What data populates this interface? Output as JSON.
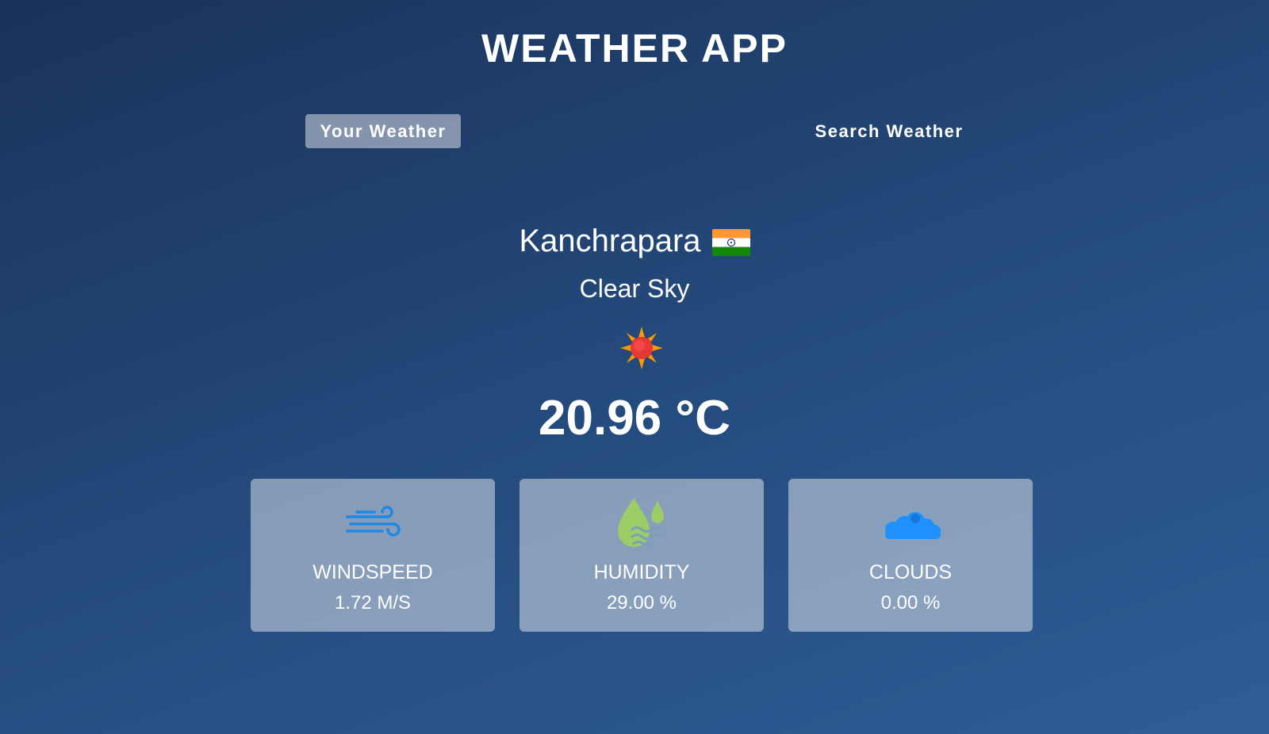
{
  "app": {
    "title": "WEATHER APP"
  },
  "tabs": [
    {
      "label": "Your Weather",
      "active": true
    },
    {
      "label": "Search Weather",
      "active": false
    }
  ],
  "location": {
    "city": "Kanchrapara",
    "flag_icon": "india-flag-icon"
  },
  "weather": {
    "condition": "Clear Sky",
    "icon": "sun-icon",
    "temperature": "20.96 °C"
  },
  "metrics": [
    {
      "label": "WINDSPEED",
      "value": "1.72 M/S",
      "icon": "wind-icon"
    },
    {
      "label": "HUMIDITY",
      "value": "29.00 %",
      "icon": "humidity-icon"
    },
    {
      "label": "CLOUDS",
      "value": "0.00 %",
      "icon": "cloud-icon"
    }
  ],
  "colors": {
    "background_top": "#1a3259",
    "background_bottom": "#2f5d96",
    "card_bg": "rgba(255,255,255,0.45)",
    "wind_icon": "#1e88e5",
    "humidity_icon": "#9ccc65",
    "cloud_icon": "#1e90ff"
  }
}
